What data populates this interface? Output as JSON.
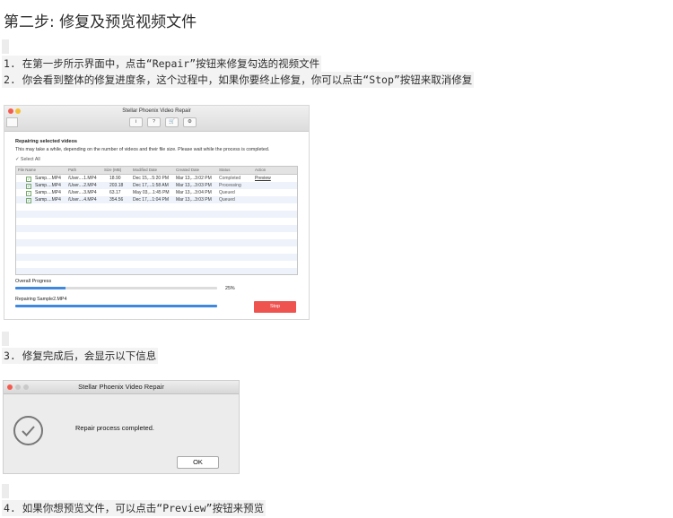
{
  "heading": "第二步: 修复及预览视频文件",
  "steps": {
    "s1": "1. 在第一步所示界面中，点击“Repair”按钮来修复勾选的视频文件",
    "s2": "2. 你会看到整体的修复进度条，这个过程中，如果你要终止修复，你可以点击“Stop”按钮来取消修复",
    "s3": "3. 修复完成后，会显示以下信息",
    "s4": "4. 如果你想预览文件，可以点击“Preview”按钮来预览"
  },
  "repair_window": {
    "title": "Stellar Phoenix Video Repair",
    "toolbar_icons": [
      "i",
      "?",
      "cart",
      "gear"
    ],
    "toolbar_glyphs": {
      "info": "i",
      "help": "?",
      "cart": "🛒",
      "settings": "⚙"
    },
    "heading": "Repairing selected videos",
    "subtext": "This may take a while, depending on the number of videos and their file size. Please wait while the process is completed.",
    "select_all": "Select All",
    "columns": [
      "File Name",
      "Path",
      "Size (MB)",
      "Modified Date",
      "Created Date",
      "Status",
      "Action"
    ],
    "rows": [
      {
        "name": "Samp....MP4",
        "path": "/User....1.MP4",
        "size": "18.90",
        "modified": "Dec 15,...5:20 PM",
        "created": "Mar 13,...3:02 PM",
        "status": "Completed",
        "action": "Preview"
      },
      {
        "name": "Samp....MP4",
        "path": "/User....2.MP4",
        "size": "203.18",
        "modified": "Dec 17,...1:58 AM",
        "created": "Mar 13,...3:03 PM",
        "status": "Processing",
        "action": ""
      },
      {
        "name": "Samp....MP4",
        "path": "/User....3.MP4",
        "size": "63.17",
        "modified": "May 03,...1:45 PM",
        "created": "Mar 13,...3:04 PM",
        "status": "Queued",
        "action": ""
      },
      {
        "name": "Samp....MP4",
        "path": "/User....4.MP4",
        "size": "354.56",
        "modified": "Dec 17,...1:04 PM",
        "created": "Mar 13,...3:03 PM",
        "status": "Queued",
        "action": ""
      }
    ],
    "overall_label": "Overall Progress",
    "overall_percent": "25%",
    "overall_fraction": 0.25,
    "current_label": "Repairing Sample2.MP4",
    "current_fraction": 1.0,
    "stop_label": "Stop",
    "colors": {
      "accent": "#3f88df",
      "stop": "#ef5350"
    }
  },
  "complete_dialog": {
    "title": "Stellar Phoenix Video Repair",
    "message": "Repair process completed.",
    "ok_label": "OK",
    "icon": "check-circle-icon"
  }
}
